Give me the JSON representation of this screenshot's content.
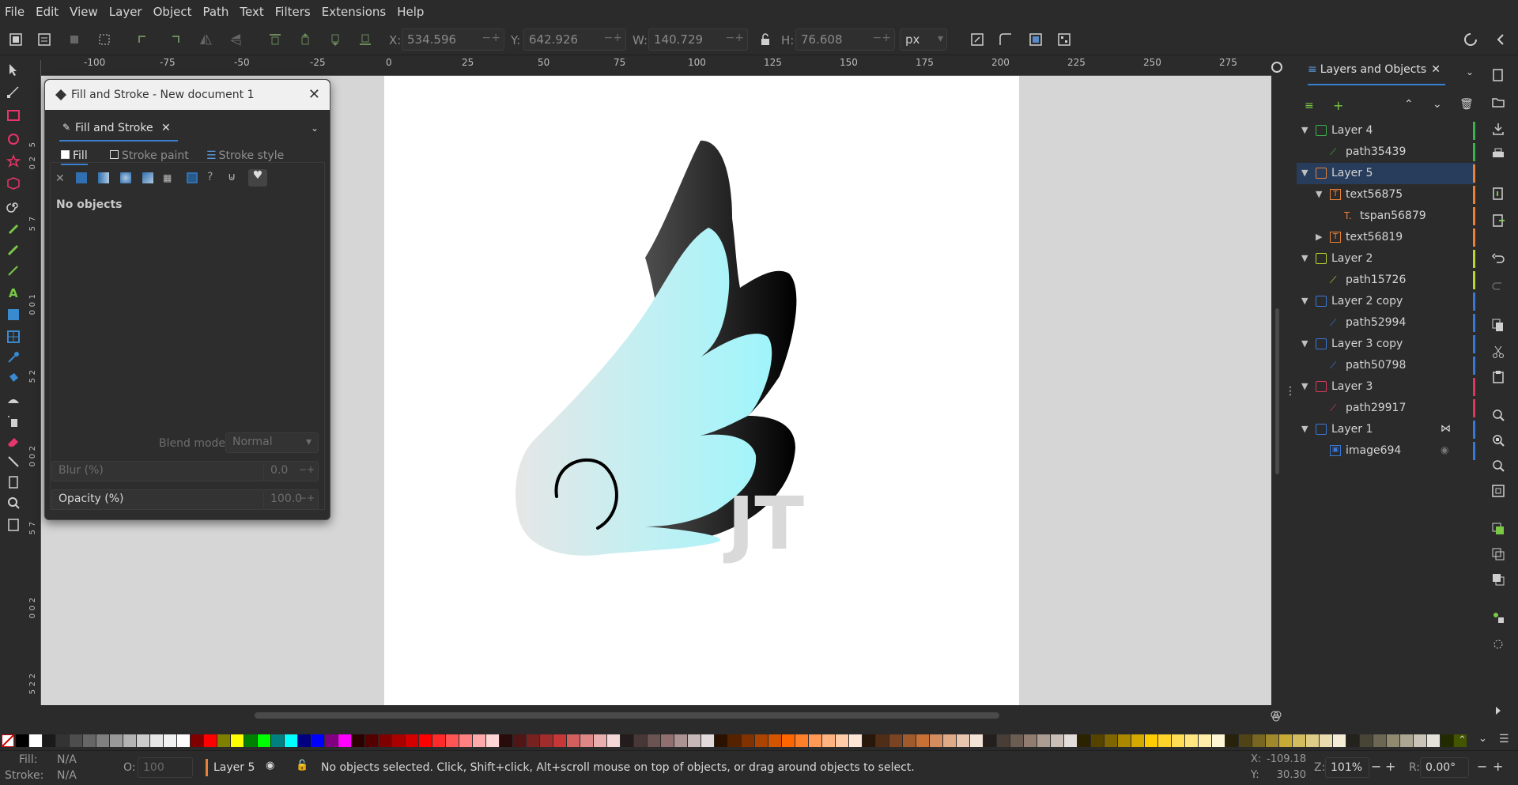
{
  "menu": [
    "File",
    "Edit",
    "View",
    "Layer",
    "Object",
    "Path",
    "Text",
    "Filters",
    "Extensions",
    "Help"
  ],
  "toolbar": {
    "x_label": "X:",
    "x_value": "534.596",
    "y_label": "Y:",
    "y_value": "642.926",
    "w_label": "W:",
    "w_value": "140.729",
    "h_label": "H:",
    "h_value": "76.608",
    "unit": "px"
  },
  "ruler": {
    "h_ticks": [
      "-100",
      "-75",
      "-50",
      "-25",
      "0",
      "25",
      "50",
      "75",
      "100",
      "125",
      "150",
      "175",
      "200",
      "225",
      "250",
      "275"
    ],
    "v_ticks": [
      "5",
      "2",
      "0",
      "7",
      "5",
      "1",
      "0",
      "0",
      "2",
      "5",
      "2",
      "0",
      "0",
      "7",
      "5",
      "2",
      "0",
      "0",
      "2",
      "2",
      "5"
    ]
  },
  "fill_stroke": {
    "title": "Fill and Stroke - New document 1",
    "tab_label": "Fill and Stroke",
    "subtabs": {
      "fill": "Fill",
      "stroke_paint": "Stroke paint",
      "stroke_style": "Stroke style"
    },
    "status": "No objects",
    "blend_label": "Blend mode:",
    "blend_value": "Normal",
    "blur_label": "Blur (%)",
    "blur_value": "0.0",
    "opacity_label": "Opacity (%)",
    "opacity_value": "100.0"
  },
  "layers_panel": {
    "title": "Layers and Objects",
    "rows": [
      {
        "label": "Layer 4",
        "type": "layer",
        "color": "#3cb34a"
      },
      {
        "label": "path35439",
        "type": "path",
        "color": "#3cb34a"
      },
      {
        "label": "Layer 5",
        "type": "layer",
        "color": "#e8823a",
        "selected": true
      },
      {
        "label": "text56875",
        "type": "text",
        "color": "#e8823a"
      },
      {
        "label": "tspan56879",
        "type": "tspan",
        "color": "#e8823a"
      },
      {
        "label": "text56819",
        "type": "text",
        "color": "#e8823a"
      },
      {
        "label": "Layer 2",
        "type": "layer",
        "color": "#b9d62c"
      },
      {
        "label": "path15726",
        "type": "path",
        "color": "#b9d62c"
      },
      {
        "label": "Layer 2 copy",
        "type": "layer",
        "color": "#3a78d6"
      },
      {
        "label": "path52994",
        "type": "path",
        "color": "#3a78d6"
      },
      {
        "label": "Layer 3 copy",
        "type": "layer",
        "color": "#3a78d6"
      },
      {
        "label": "path50798",
        "type": "path",
        "color": "#3a78d6"
      },
      {
        "label": "Layer 3",
        "type": "layer",
        "color": "#d93a5c"
      },
      {
        "label": "path29917",
        "type": "path",
        "color": "#d93a5c"
      },
      {
        "label": "Layer 1",
        "type": "layer",
        "color": "#3a78d6"
      },
      {
        "label": "image694",
        "type": "image",
        "color": "#3a78d6"
      }
    ]
  },
  "canvas_text": "JT",
  "status": {
    "fill_label": "Fill:",
    "fill_value": "N/A",
    "stroke_label": "Stroke:",
    "stroke_value": "N/A",
    "opacity_label": "O:",
    "opacity_value": "100",
    "layer": "Layer 5",
    "message": "No objects selected. Click, Shift+click, Alt+scroll mouse on top of objects, or drag around objects to select.",
    "x_label": "X:",
    "x_value": "-109.18",
    "y_label": "Y:",
    "y_value": "30.30",
    "zoom_label": "Z:",
    "zoom_value": "101%",
    "rotate_label": "R:",
    "rotate_value": "0.00°"
  },
  "palette": [
    "#000000",
    "#ffffff",
    "#1a1a1a",
    "#333333",
    "#4d4d4d",
    "#666666",
    "#808080",
    "#999999",
    "#b3b3b3",
    "#cccccc",
    "#e6e6e6",
    "#f2f2f2",
    "#ffffff",
    "#800000",
    "#ff0000",
    "#808000",
    "#ffff00",
    "#008000",
    "#00ff00",
    "#008080",
    "#00ffff",
    "#000080",
    "#0000ff",
    "#800080",
    "#ff00ff",
    "#2b0000",
    "#550000",
    "#800000",
    "#aa0000",
    "#d40000",
    "#ff0000",
    "#ff2a2a",
    "#ff5555",
    "#ff8080",
    "#ffaaaa",
    "#ffd5d5",
    "#280b0b",
    "#501616",
    "#782121",
    "#a02c2c",
    "#c83737",
    "#d35f5f",
    "#de8787",
    "#e9afaf",
    "#f4d7d7",
    "#241c1c",
    "#483737",
    "#6c5353",
    "#916f6f",
    "#ac9393",
    "#c8b7b7",
    "#e3dbdb",
    "#2b1100",
    "#552200",
    "#803300",
    "#aa4400",
    "#d45500",
    "#ff6600",
    "#ff7f2a",
    "#ff9955",
    "#ffb380",
    "#ffccaa",
    "#ffe6d5",
    "#28170b",
    "#502d16",
    "#784421",
    "#a05a2c",
    "#c87137",
    "#d38d5f",
    "#deaa87",
    "#e9c6af",
    "#f4e3d7",
    "#241f1c",
    "#483e37",
    "#6c5d53",
    "#917c6f",
    "#ac9d93",
    "#c8beb7",
    "#e3dedb",
    "#2b2200",
    "#554400",
    "#806600",
    "#aa8800",
    "#d4aa00",
    "#ffcc00",
    "#ffd42a",
    "#ffdd55",
    "#ffe680",
    "#ffeeaa",
    "#fff6d5",
    "#28220b",
    "#504416",
    "#786721",
    "#a0892c",
    "#c8ab37",
    "#d3bc5f",
    "#decd87",
    "#e9ddaf",
    "#f4eed7",
    "#24221c",
    "#484537",
    "#6c6753",
    "#918a6f",
    "#aca793",
    "#c8c4b7",
    "#e3e2db",
    "#222b00",
    "#445500"
  ],
  "colors": {
    "accent": "#3b7fd0",
    "selection": "#283d5c",
    "wing_light": "#9ff5fb",
    "wing_pale": "#e6e6e6",
    "jt_text": "#d9d9d9"
  },
  "icons": [
    "selector-icon",
    "node-icon",
    "rect-icon",
    "ellipse-icon",
    "star-icon",
    "3dbox-icon",
    "spiral-icon",
    "pen-icon",
    "pencil-icon",
    "calligraphy-icon",
    "text-icon",
    "gradient-icon",
    "mesh-icon",
    "dropper-icon",
    "paintbucket-icon",
    "tweak-icon",
    "spray-icon",
    "eraser-icon",
    "connector-icon",
    "pages-icon",
    "zoom-icon",
    "measure-icon"
  ]
}
